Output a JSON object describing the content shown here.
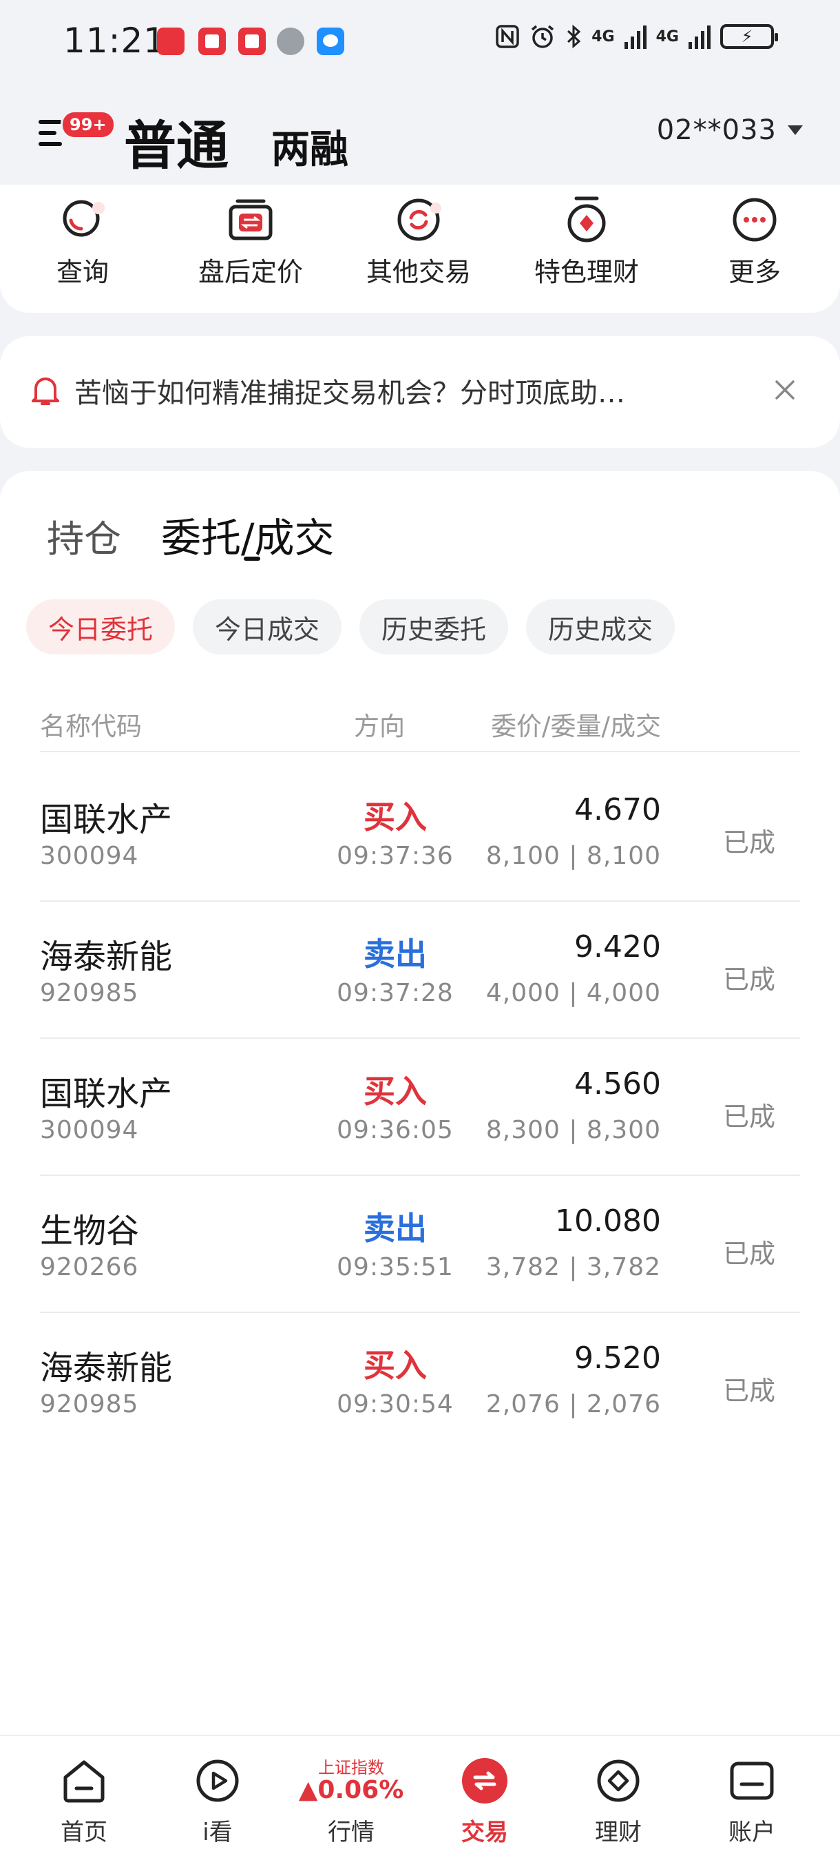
{
  "status_bar": {
    "time": "11:21",
    "network_1": "4G",
    "network_2": "4G"
  },
  "header": {
    "badge": "99+",
    "tab_normal": "普通",
    "tab_margin": "两融",
    "account": "02**033"
  },
  "quick_menu": [
    {
      "label": "查询",
      "icon": "search-icon"
    },
    {
      "label": "盘后定价",
      "icon": "exchange-card-icon"
    },
    {
      "label": "其他交易",
      "icon": "refresh-circle-icon"
    },
    {
      "label": "特色理财",
      "icon": "medal-icon"
    },
    {
      "label": "更多",
      "icon": "more-dots-icon"
    }
  ],
  "banner": {
    "text": "苦恼于如何精准捕捉交易机会？分时顶底助…"
  },
  "main": {
    "tab_hold": "持仓",
    "tab_entrust": "委托/成交",
    "chips": [
      "今日委托",
      "今日成交",
      "历史委托",
      "历史成交"
    ],
    "headers": {
      "name": "名称代码",
      "direction": "方向",
      "price": "委价/委量/成交"
    },
    "rows": [
      {
        "name": "国联水产",
        "code": "300094",
        "direction": "买入",
        "side": "buy",
        "time": "09:37:36",
        "price": "4.670",
        "qty": "8,100 | 8,100",
        "status": "已成"
      },
      {
        "name": "海泰新能",
        "code": "920985",
        "direction": "卖出",
        "side": "sell",
        "time": "09:37:28",
        "price": "9.420",
        "qty": "4,000 | 4,000",
        "status": "已成"
      },
      {
        "name": "国联水产",
        "code": "300094",
        "direction": "买入",
        "side": "buy",
        "time": "09:36:05",
        "price": "4.560",
        "qty": "8,300 | 8,300",
        "status": "已成"
      },
      {
        "name": "生物谷",
        "code": "920266",
        "direction": "卖出",
        "side": "sell",
        "time": "09:35:51",
        "price": "10.080",
        "qty": "3,782 | 3,782",
        "status": "已成"
      },
      {
        "name": "海泰新能",
        "code": "920985",
        "direction": "买入",
        "side": "buy",
        "time": "09:30:54",
        "price": "9.520",
        "qty": "2,076 | 2,076",
        "status": "已成"
      }
    ]
  },
  "bottom_nav": {
    "home": "首页",
    "watch": "i看",
    "market": "行情",
    "market_index_name": "上证指数",
    "market_index_value": "▲0.06%",
    "trade": "交易",
    "wealth": "理财",
    "account": "账户"
  },
  "colors": {
    "accent_red": "#e0333b",
    "sell_blue": "#2a6fdb"
  }
}
